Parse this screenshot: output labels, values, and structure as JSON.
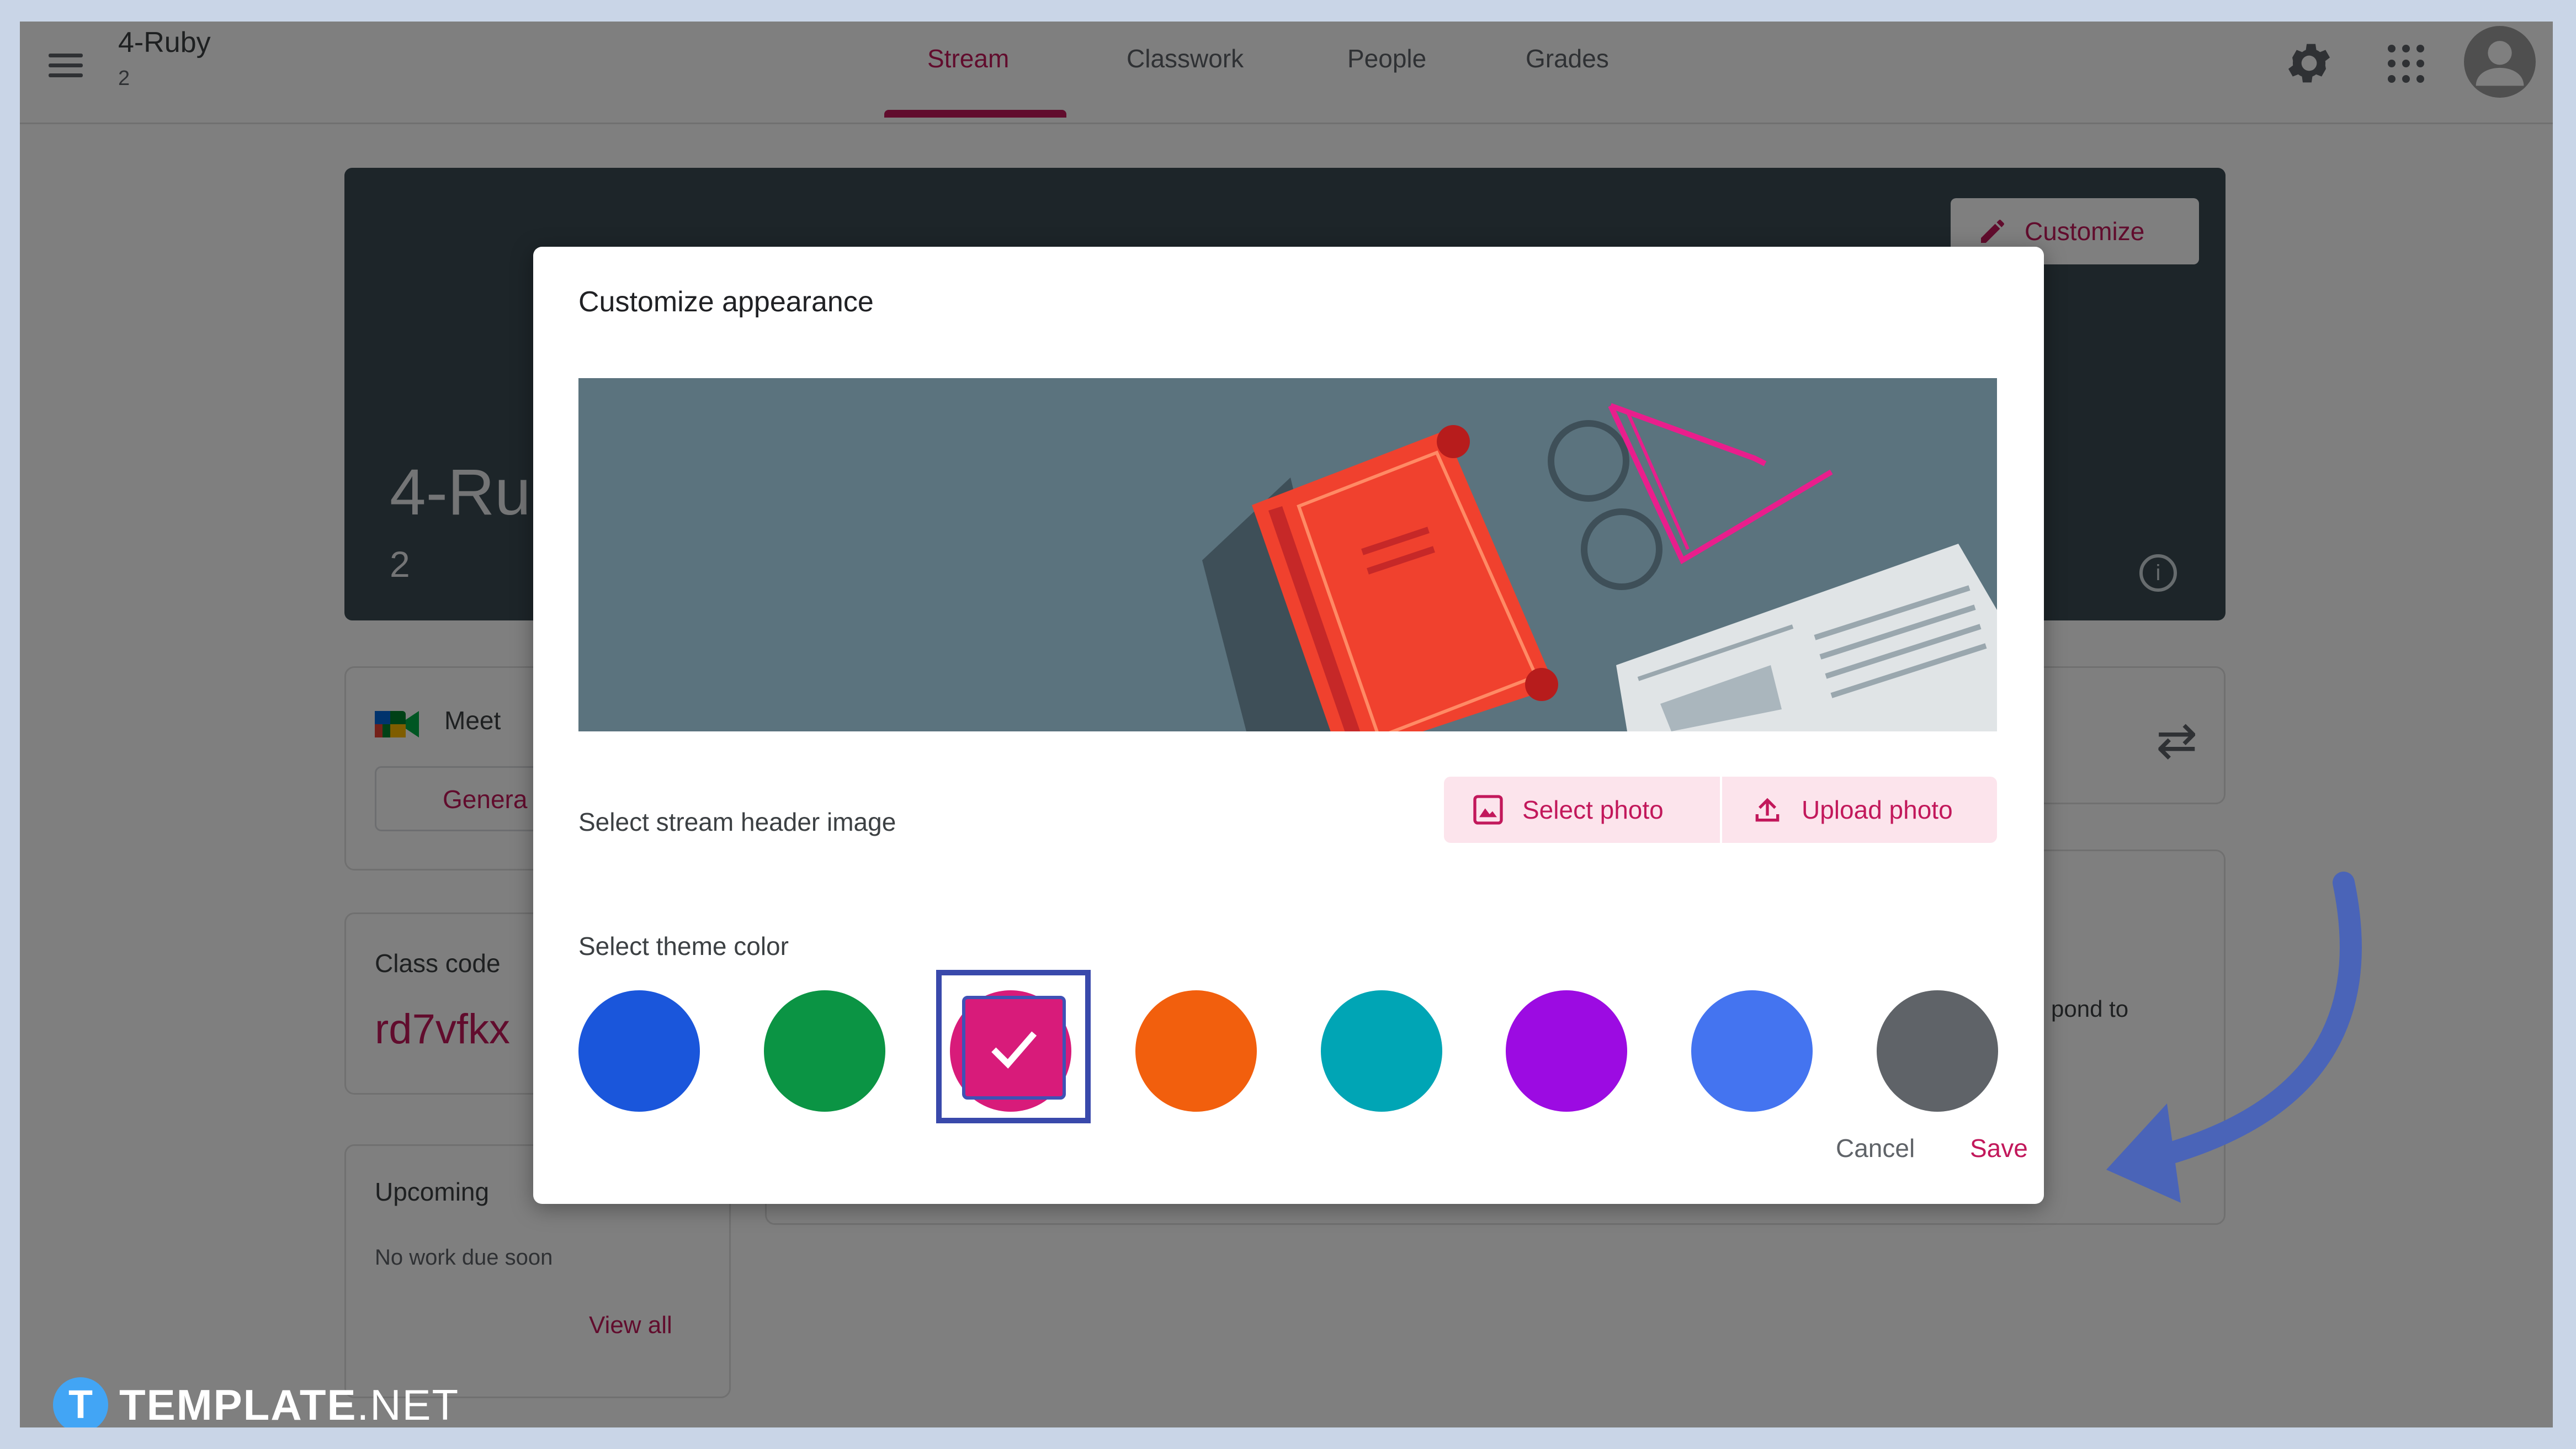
{
  "header": {
    "class_name": "4-Ruby",
    "class_section": "2",
    "tabs": [
      {
        "label": "Stream",
        "active": true
      },
      {
        "label": "Classwork",
        "active": false
      },
      {
        "label": "People",
        "active": false
      },
      {
        "label": "Grades",
        "active": false
      }
    ],
    "icons": [
      "menu-icon",
      "gear-icon",
      "apps-icon",
      "avatar"
    ]
  },
  "banner": {
    "title": "4-Ru",
    "subtitle": "2",
    "customize_label": "Customize"
  },
  "meet": {
    "label": "Meet",
    "button": "Genera"
  },
  "class_code": {
    "label": "Class code",
    "value": "rd7vfkx"
  },
  "upcoming": {
    "label": "Upcoming",
    "empty_text": "No work due soon",
    "view_all": "View all"
  },
  "stream_snippet": "pond to",
  "modal": {
    "title": "Customize appearance",
    "header_image_label": "Select stream header image",
    "select_photo": "Select photo",
    "upload_photo": "Upload photo",
    "theme_label": "Select theme color",
    "theme_colors": [
      "#1a56db",
      "#0b9444",
      "#d81b7a",
      "#f25f0d",
      "#00a5b5",
      "#9c0be2",
      "#4474f0",
      "#5f6368"
    ],
    "selected_color_index": 2,
    "cancel": "Cancel",
    "save": "Save"
  },
  "watermark": {
    "brand": "TEMPLATE",
    "suffix": ".NET",
    "badge": "T"
  },
  "colors": {
    "accent": "#c2185b",
    "highlight_box": "#3949ab",
    "arrow": "#4a64b8"
  }
}
